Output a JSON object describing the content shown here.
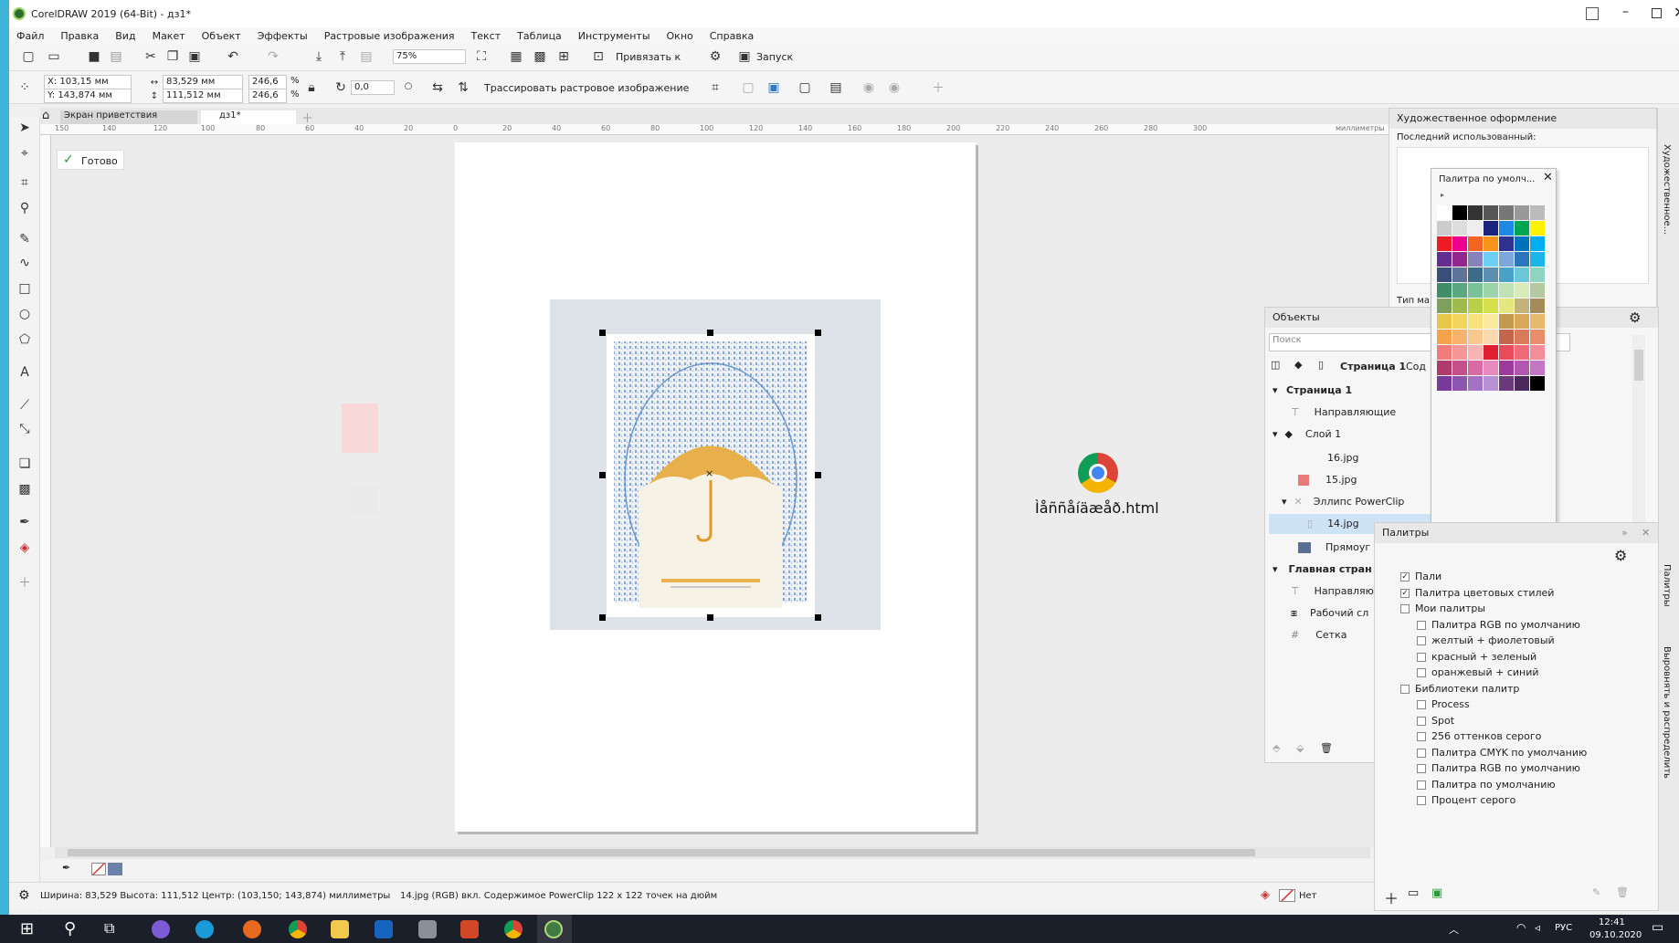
{
  "window": {
    "title": "CorelDRAW 2019 (64-Bit) - дз1*"
  },
  "menu": [
    "Файл",
    "Правка",
    "Вид",
    "Макет",
    "Объект",
    "Эффекты",
    "Растровые изображения",
    "Текст",
    "Таблица",
    "Инструменты",
    "Окно",
    "Справка"
  ],
  "toolbar": {
    "zoom": "75%",
    "snap_label": "Привязать к",
    "launch_label": "Запуск"
  },
  "props": {
    "x": "X: 103,15 мм",
    "y": "Y: 143,874 мм",
    "w": "83,529 мм",
    "h": "111,512 мм",
    "sx": "246,6",
    "sy": "246,6",
    "pct": "%",
    "angle": "0,0",
    "trace": "Трассировать растровое изображение"
  },
  "tabs": {
    "welcome": "Экран приветствия",
    "doc": "дз1*"
  },
  "status": {
    "ready": "Готово",
    "info": "Ширина: 83,529  Высота: 111,512  Центр: (103,150; 143,874)  миллиметры",
    "object": "14.jpg (RGB) вкл. Содержимое PowerClip 122 x 122 точек на дюйм",
    "fill": "Нет"
  },
  "ruler": {
    "top": [
      "150",
      "140",
      "120",
      "100",
      "80",
      "60",
      "40",
      "20",
      "0",
      "20",
      "40",
      "60",
      "80",
      "100",
      "120",
      "140",
      "160",
      "180",
      "200",
      "220",
      "240",
      "260",
      "280",
      "300"
    ],
    "unit": "миллиметры"
  },
  "desktop_file": "Ìåññåíäæåð.html",
  "artistic": {
    "title": "Художественное оформление",
    "last_used": "Последний использованный:",
    "type": "Тип ма"
  },
  "palette_popup": {
    "title": "Палитра по умолч..."
  },
  "objects": {
    "title": "Объекты",
    "search": "Поиск",
    "page_label": "Страница 1",
    "content_label": "Сод",
    "tree": [
      {
        "label": "Страница 1",
        "bold": true,
        "indent": 0
      },
      {
        "label": "Направляющие",
        "indent": 1
      },
      {
        "label": "Слой 1",
        "indent": 1
      },
      {
        "label": "16.jpg",
        "indent": 2
      },
      {
        "label": "15.jpg",
        "indent": 2
      },
      {
        "label": "Эллипс PowerClip",
        "indent": 2
      },
      {
        "label": "14.jpg",
        "indent": 3
      },
      {
        "label": "Прямоуг",
        "indent": 2
      },
      {
        "label": "Главная стран",
        "bold": true,
        "indent": 0
      },
      {
        "label": "Направляю",
        "indent": 1
      },
      {
        "label": "Рабочий сл",
        "indent": 1
      },
      {
        "label": "Сетка",
        "indent": 1
      }
    ]
  },
  "palettes": {
    "title": "Палитры",
    "items": [
      {
        "label": "Пали",
        "checked": true,
        "indent": 1
      },
      {
        "label": "Палитра цветовых стилей",
        "checked": true,
        "indent": 1
      },
      {
        "label": "Мои палитры",
        "checked": false,
        "indent": 1
      },
      {
        "label": "Палитра RGB по умолчанию",
        "checked": false,
        "indent": 2
      },
      {
        "label": "желтый + фиолетовый",
        "checked": false,
        "indent": 2
      },
      {
        "label": "красный + зеленый",
        "checked": false,
        "indent": 2
      },
      {
        "label": "оранжевый + синий",
        "checked": false,
        "indent": 2
      },
      {
        "label": "Библиотеки палитр",
        "checked": false,
        "indent": 1
      },
      {
        "label": "Process",
        "checked": false,
        "indent": 2
      },
      {
        "label": "Spot",
        "checked": false,
        "indent": 2
      },
      {
        "label": "256 оттенков серого",
        "checked": false,
        "indent": 2
      },
      {
        "label": "Палитра CMYK по умолчанию",
        "checked": false,
        "indent": 2
      },
      {
        "label": "Палитра RGB по умолчанию",
        "checked": false,
        "indent": 2
      },
      {
        "label": "Палитра по умолчанию",
        "checked": false,
        "indent": 2
      },
      {
        "label": "Процент серого",
        "checked": false,
        "indent": 2
      }
    ]
  },
  "side_tabs": {
    "artistic": "Художественное...",
    "palettes": "Палитры",
    "align": "Выровнять и распределить"
  },
  "tray": {
    "lang": "РУС",
    "time": "12:41",
    "date": "09.10.2020"
  },
  "colors": {
    "accent": "#3fb4d8",
    "taskbar": "#1b1f2a",
    "umbrella": "#e8b04a",
    "rain": "#5a88c0"
  }
}
